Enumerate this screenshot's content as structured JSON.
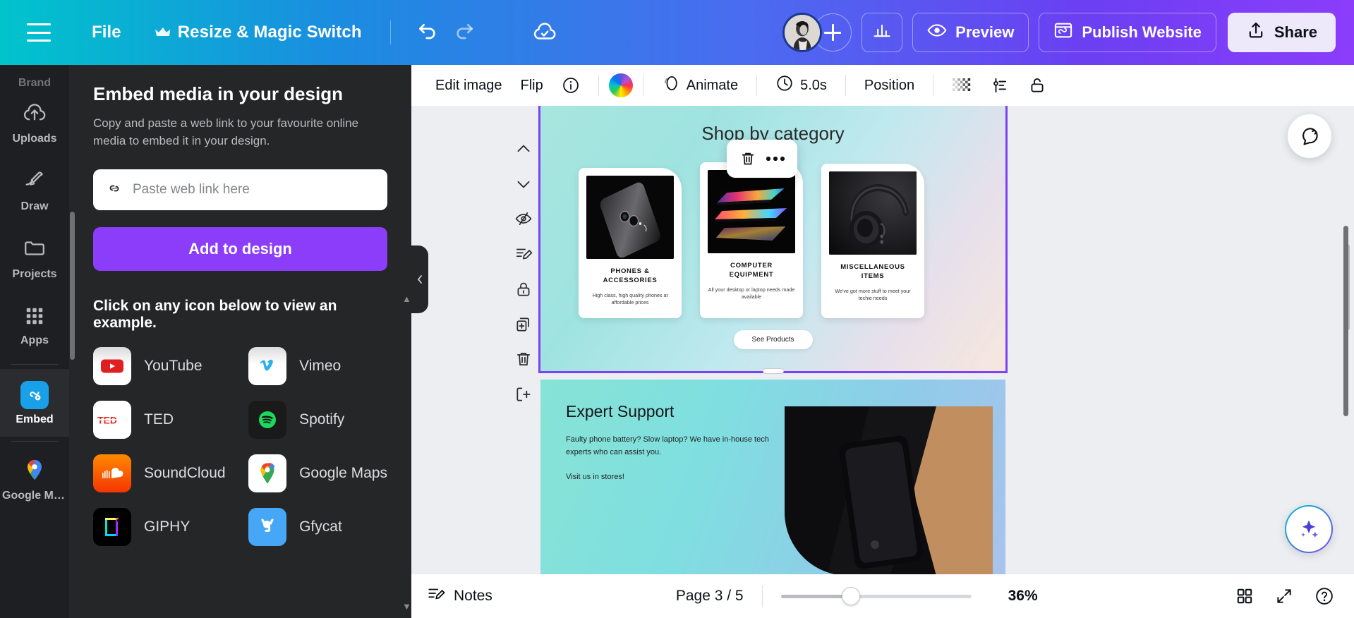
{
  "topbar": {
    "menu_icon": "hamburger-icon",
    "file_label": "File",
    "resize_label": "Resize & Magic Switch",
    "crown_icon": "crown-icon",
    "undo_icon": "undo-icon",
    "redo_icon": "redo-icon",
    "cloud_icon": "cloud-check-icon",
    "add_person_icon": "plus-icon",
    "insights_icon": "bar-chart-icon",
    "preview_label": "Preview",
    "preview_icon": "eye-icon",
    "publish_label": "Publish Website",
    "publish_icon": "website-icon",
    "share_label": "Share",
    "share_icon": "share-upload-icon"
  },
  "rail": {
    "items": [
      {
        "label": "Brand",
        "icon": "brand-icon",
        "active": false
      },
      {
        "label": "Uploads",
        "icon": "cloud-upload-icon",
        "active": false
      },
      {
        "label": "Draw",
        "icon": "pen-icon",
        "active": false
      },
      {
        "label": "Projects",
        "icon": "folder-icon",
        "active": false
      },
      {
        "label": "Apps",
        "icon": "grid-apps-icon",
        "active": false
      },
      {
        "label": "Embed",
        "icon": "embed-icon",
        "active": true
      },
      {
        "label": "Google Ma...",
        "icon": "google-maps-icon",
        "active": false
      }
    ]
  },
  "panel": {
    "title": "Embed media in your design",
    "description": "Copy and paste a web link to your favourite online media to embed it in your design.",
    "link_icon": "link-icon",
    "input_value": "",
    "input_placeholder": "Paste web link here",
    "add_button_label": "Add to design",
    "hint": "Click on any icon below to view an example.",
    "apps": [
      {
        "name": "YouTube",
        "icon": "youtube-icon"
      },
      {
        "name": "Vimeo",
        "icon": "vimeo-icon"
      },
      {
        "name": "TED",
        "icon": "ted-icon"
      },
      {
        "name": "Spotify",
        "icon": "spotify-icon"
      },
      {
        "name": "SoundCloud",
        "icon": "soundcloud-icon"
      },
      {
        "name": "Google Maps",
        "icon": "google-maps-icon"
      },
      {
        "name": "GIPHY",
        "icon": "giphy-icon"
      },
      {
        "name": "Gfycat",
        "icon": "gfycat-icon"
      }
    ]
  },
  "editor_toolbar": {
    "edit_image_label": "Edit image",
    "flip_label": "Flip",
    "info_icon": "info-icon",
    "color_icon": "color-wheel-icon",
    "animate_label": "Animate",
    "animate_icon": "animate-icon",
    "duration_label": "5.0s",
    "duration_icon": "clock-icon",
    "position_label": "Position",
    "transparency_icon": "transparency-icon",
    "spacing_icon": "spacing-icon",
    "lock_icon": "lock-open-icon"
  },
  "object_toolbar": {
    "icons": [
      "chevron-up-icon",
      "chevron-down-icon",
      "hide-icon",
      "notes-edit-icon",
      "lock-icon",
      "duplicate-icon",
      "trash-icon",
      "expand-page-icon"
    ]
  },
  "float_context": {
    "trash_icon": "trash-icon",
    "more_icon": "more-dots-icon"
  },
  "canvas": {
    "page_title": "Shop by category",
    "cards": [
      {
        "title": "PHONES & ACCESSORIES",
        "subtitle": "High class, high quality phones at affordable prices",
        "image": "black-smartphone-back-camera"
      },
      {
        "title": "COMPUTER EQUIPMENT",
        "subtitle": "All your desktop or laptop needs made available",
        "image": "colorful-laptop-stack"
      },
      {
        "title": "MISCELLANEOUS ITEMS",
        "subtitle": "We've got more stuff to meet your techie needs",
        "image": "black-headphones"
      }
    ],
    "see_products_label": "See Products",
    "section2": {
      "heading": "Expert Support",
      "body": "Faulty phone battery? Slow laptop? We have in-house tech experts who can assist you.",
      "body2": "Visit us in stores!",
      "image": "black-phone-on-wood-desk"
    },
    "comment_icon": "comment-icon",
    "magic_icon": "magic-sparkle-icon"
  },
  "bottombar": {
    "notes_label": "Notes",
    "notes_icon": "notes-icon",
    "page_label": "Page 3 / 5",
    "zoom_value": "36%",
    "grid_icon": "grid-view-icon",
    "fullscreen_icon": "expand-icon",
    "help_icon": "help-icon"
  }
}
